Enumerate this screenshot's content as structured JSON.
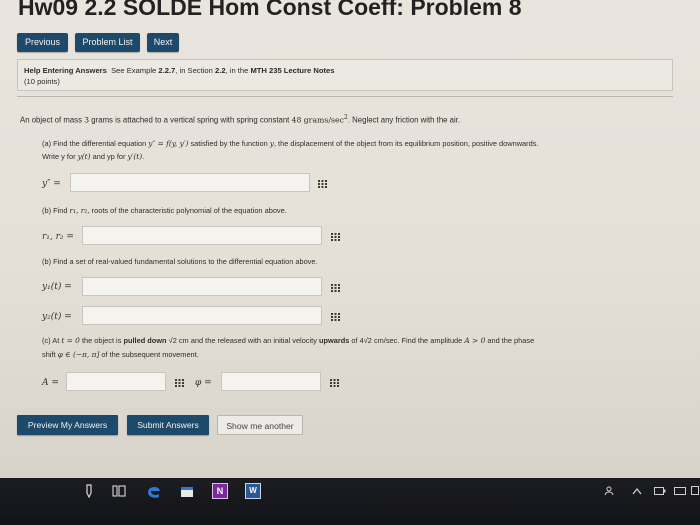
{
  "title": "Hw09 2.2 SOLDE Hom Const Coeff: Problem 8",
  "nav": {
    "previous": "Previous",
    "problem_list": "Problem List",
    "next": "Next"
  },
  "help": {
    "heading": "Help Entering Answers",
    "see": "See Example",
    "example": "2.2.7",
    "in_section": ", in Section",
    "section": "2.2",
    "in_the": ", in the",
    "notes": "MTH 235 Lecture Notes",
    "points": "(10 points)"
  },
  "problem": {
    "intro_a": "An object of mass",
    "mass": "3",
    "intro_b": "grams is attached to a vertical spring with spring constant",
    "k": "48",
    "units": "grams/sec",
    "units_exp": "2",
    "intro_c": ". Neglect any friction with the air.",
    "part_a_1": "(a) Find the differential equation",
    "part_a_eq": "y″ = f(y, y′)",
    "part_a_2": "satisfied by the function",
    "part_a_y": "y",
    "part_a_3": ", the displacement of the object from its equilibrium position, positive downwards.",
    "part_a_line2a": "Write y for",
    "part_a_yt": "y(t)",
    "part_a_line2b": "and yp for",
    "part_a_ypt": "y′(t)",
    "part_a_line2c": ".",
    "label_ypp": "y″ =",
    "part_b1_a": "(b) Find",
    "part_b1_roots": "r₁, r₂,",
    "part_b1_b": "roots of the characteristic polynomial of the equation above.",
    "label_roots": "r₁, r₂ =",
    "part_b2": "(b) Find a set of real-valued fundamental solutions to the differential equation above.",
    "label_y1": "y₁(t) =",
    "label_y2": "y₂(t) =",
    "part_c_1": "(c) At",
    "part_c_t0": "t = 0",
    "part_c_2": "the object is",
    "part_c_bold1": "pulled down",
    "part_c_3": "√2 cm and the released with an initial velocity",
    "part_c_bold2": "upwards",
    "part_c_4": "of 4√2 cm/sec. Find the amplitude",
    "part_c_amp": "A > 0",
    "part_c_5": "and the phase",
    "part_c_line2a": "shift",
    "part_c_phi": "φ ∈ (−π, π]",
    "part_c_line2b": "of the subsequent movement.",
    "label_A": "A =",
    "label_phi": "φ ="
  },
  "buttons": {
    "preview": "Preview My Answers",
    "submit": "Submit Answers",
    "another": "Show me another"
  },
  "taskbar": {
    "icons": [
      "pen-icon",
      "task-view-icon",
      "edge-icon",
      "store-icon",
      "onenote-icon",
      "word-icon",
      "people-icon",
      "chevron-up-icon",
      "battery-icon",
      "keyboard-icon",
      "notification-icon"
    ],
    "onenote_letter": "N",
    "word_letter": "W"
  },
  "colors": {
    "button": "#1d4a6b",
    "page_bg": "#e7e3dc",
    "taskbar": "#18191d"
  }
}
